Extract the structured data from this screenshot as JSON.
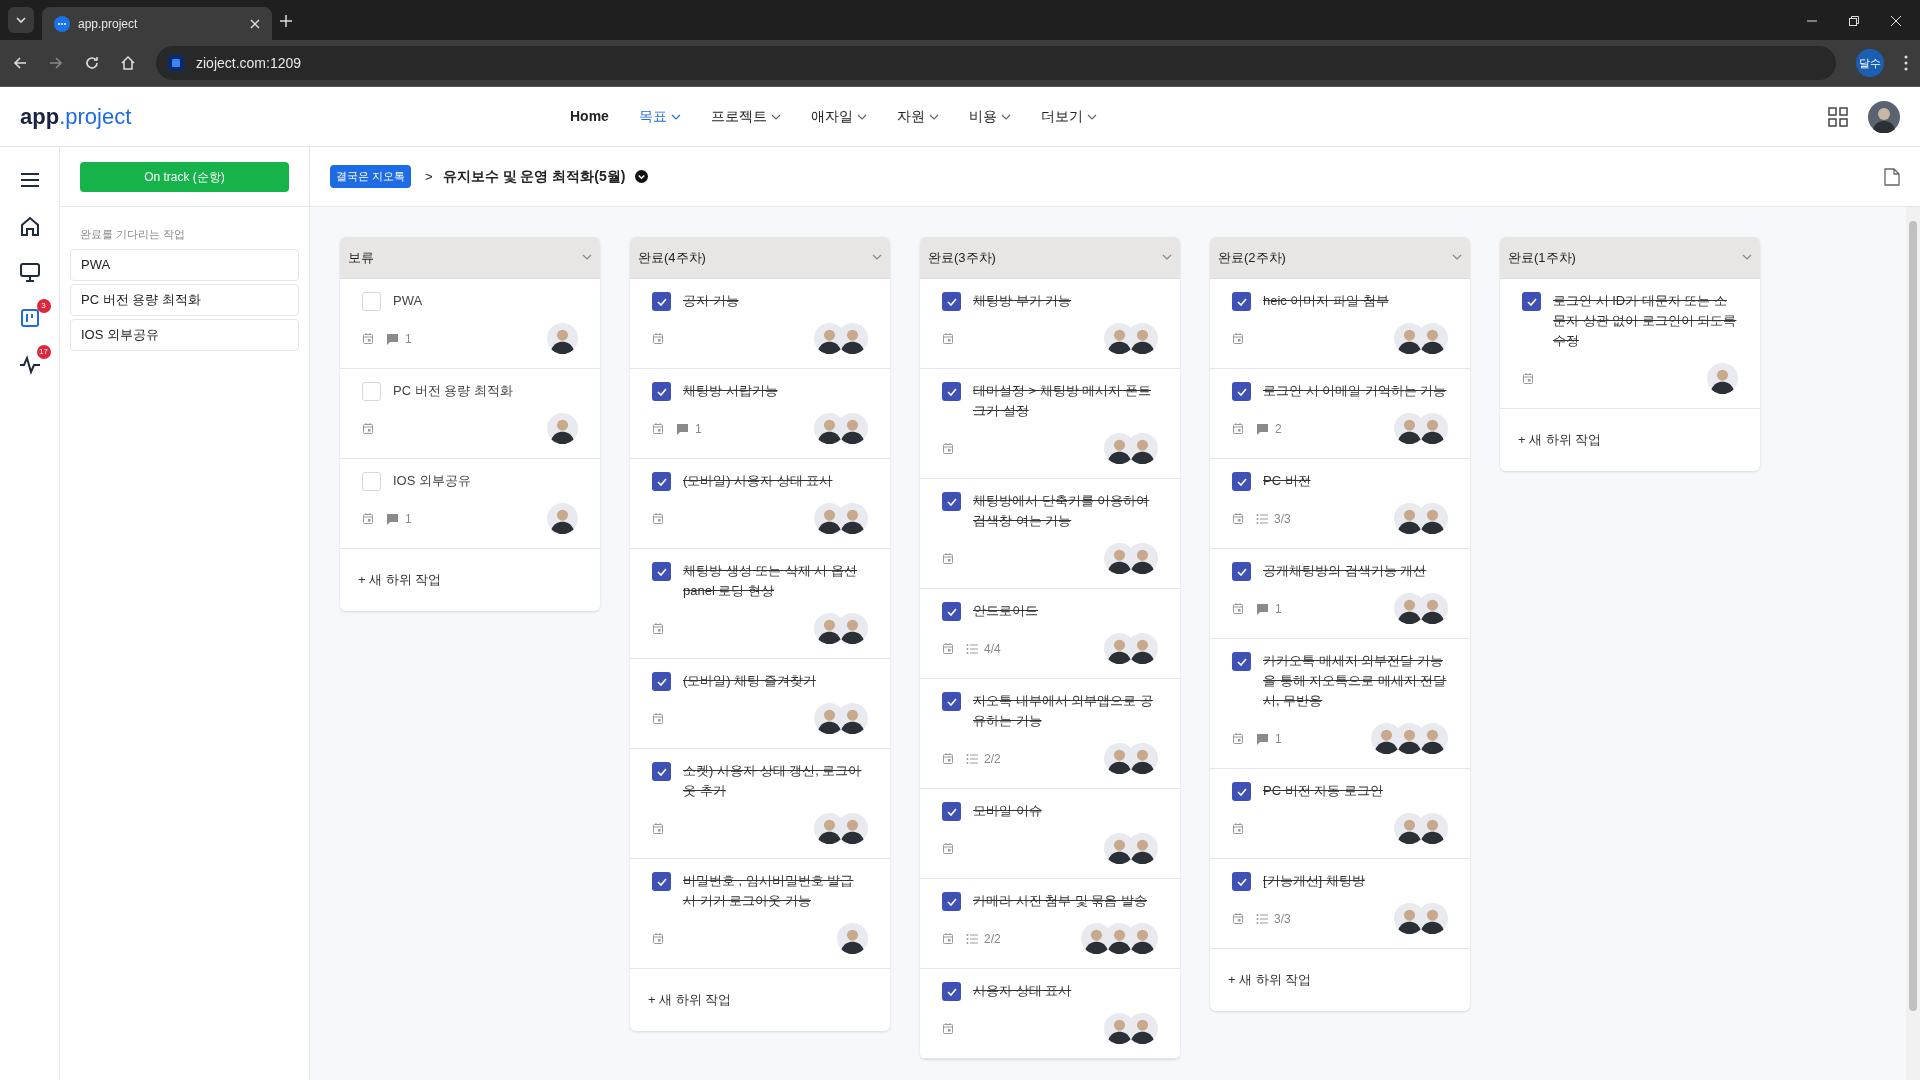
{
  "browser": {
    "tab_title": "app.project",
    "url": "zioject.com:1209",
    "profile": "달수"
  },
  "header": {
    "logo": "**app**.project",
    "nav": [
      {
        "label": "Home",
        "selected": false,
        "dropdown": false
      },
      {
        "label": "목표",
        "selected": true,
        "dropdown": true
      },
      {
        "label": "프로젝트",
        "selected": false,
        "dropdown": true
      },
      {
        "label": "애자일",
        "selected": false,
        "dropdown": true
      },
      {
        "label": "자원",
        "selected": false,
        "dropdown": true
      },
      {
        "label": "비용",
        "selected": false,
        "dropdown": true
      },
      {
        "label": "더보기",
        "selected": false,
        "dropdown": true
      }
    ]
  },
  "sidebar": {
    "items": [
      {
        "kind": "menu",
        "selected": false
      },
      {
        "kind": "home",
        "selected": false
      },
      {
        "kind": "monitor",
        "selected": false
      },
      {
        "kind": "board",
        "selected": true,
        "badge": "3"
      },
      {
        "kind": "activity",
        "selected": false,
        "badge": "17"
      }
    ]
  },
  "left_panel": {
    "status_button": "On track (순항)",
    "section_label": "완료를 기다리는 작업",
    "items": [
      "PWA",
      "PC 버전 용량 최적화",
      "IOS 외부공유"
    ]
  },
  "breadcrumb": {
    "project": "결국은 지오톡",
    "separator": ">",
    "goal": "유지보수 및 운영 최적화(5월)"
  },
  "columns": [
    {
      "title": "보류",
      "add_label": "+ 새 하위 작업",
      "cards": [
        {
          "title": "PWA",
          "checked": false,
          "comments": "1"
        },
        {
          "title": "PC 버전 용량 최적화",
          "checked": false
        },
        {
          "title": "IOS 외부공유",
          "checked": false,
          "comments": "1"
        }
      ]
    },
    {
      "title": "완료(4주차)",
      "add_label": "+ 새 하위 작업",
      "cards": [
        {
          "title": "공지 기능",
          "checked": true
        },
        {
          "title": "채팅방 서랍기능",
          "checked": true,
          "comments": "1"
        },
        {
          "title": "(모바일) 사용자 상태 표시",
          "checked": true
        },
        {
          "title": "채팅방 생성 또는 삭제 시 옵션 panel 로딩 현상",
          "checked": true
        },
        {
          "title": "(모바일) 채팅 즐겨찾기",
          "checked": true
        },
        {
          "title": "소켓) 사용자 상태 갱신, 로그아웃 추가",
          "checked": true
        },
        {
          "title": "비밀번호 , 임시비밀번호 발급 시 기기 로그아웃 기능",
          "checked": true
        }
      ]
    },
    {
      "title": "완료(3주차)",
      "cards": [
        {
          "title": "채팅방 부가 기능",
          "checked": true
        },
        {
          "title": "테마설정 > 채팅방 메시지 폰트 크기 설정",
          "checked": true
        },
        {
          "title": "채팅방에서 단축키를 이용하여 검색창 여는 기능",
          "checked": true
        },
        {
          "title": "안드로이드",
          "checked": true,
          "subtasks": "4/4"
        },
        {
          "title": "지오톡 내부에서 외부앱으로 공유하는 기능",
          "checked": true,
          "subtasks": "2/2"
        },
        {
          "title": "모바일 이슈",
          "checked": true
        },
        {
          "title": "카메라 사진 첨부 및 묶음 발송",
          "checked": true,
          "subtasks": "2/2"
        },
        {
          "title": "사용자 상태 표시",
          "checked": true
        }
      ]
    },
    {
      "title": "완료(2주차)",
      "add_label": "+ 새 하위 작업",
      "cards": [
        {
          "title": "heic 이미지 파일 첨부",
          "checked": true
        },
        {
          "title": "로그인 시 이메일 기억하는 기능",
          "checked": true,
          "comments": "2"
        },
        {
          "title": "PC 버전",
          "checked": true,
          "subtasks": "3/3"
        },
        {
          "title": "공개채팅방의 검색기능 개선",
          "checked": true,
          "comments": "1"
        },
        {
          "title": "카카오톡 메세지 외부전달 기능을 통해 지오톡으로 메세지 전달 시, 무반응",
          "checked": true,
          "comments": "1"
        },
        {
          "title": "PC 버전 자동 로그인",
          "checked": true
        },
        {
          "title": "[기능개선] 채팅방",
          "checked": true,
          "subtasks": "3/3"
        }
      ]
    },
    {
      "title": "완료(1주차)",
      "add_label": "+ 새 하위 작업",
      "cards": [
        {
          "title": "로그인 시 ID가 대문자 또는 소문자 상관 없이 로그인이 되도록 수정",
          "checked": true
        }
      ]
    }
  ]
}
